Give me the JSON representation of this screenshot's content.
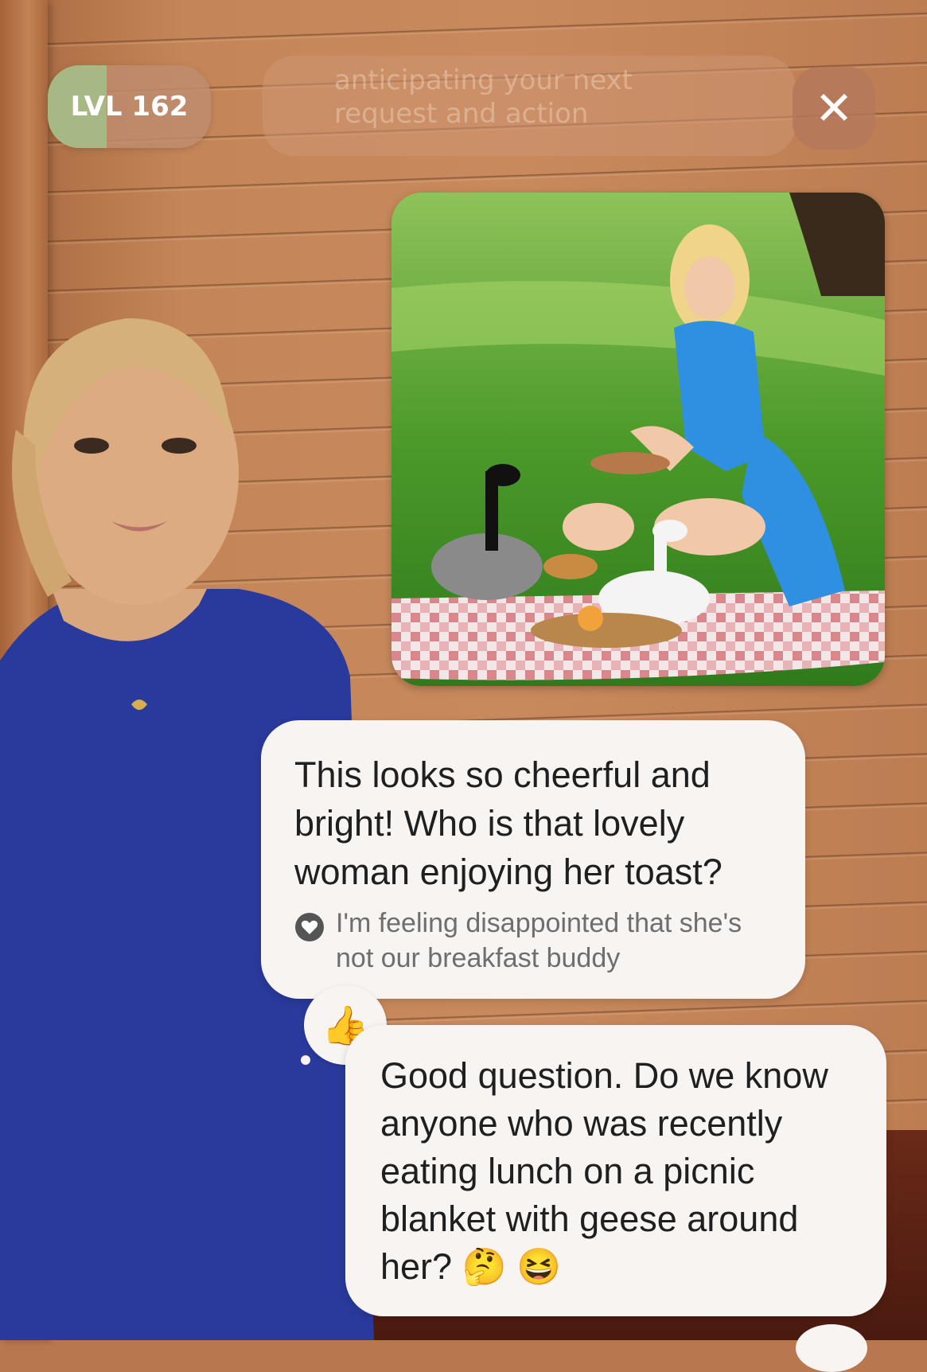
{
  "header": {
    "level_label": "LVL 162",
    "level_progress": 0.36,
    "hint_text": "anticipating your next request and action",
    "close_glyph": "✕"
  },
  "photo": {
    "icon": "image"
  },
  "chat": {
    "user_message": "This looks so cheerful and bright! Who is that lovely woman enjoying her toast?",
    "emotion_text": "I'm feeling disappointed that she's not our breakfast buddy",
    "emotion_icon": "heart-icon",
    "reaction_emoji": "👍",
    "ai_message": "Good question. Do we know anyone who was recently eating lunch on a picnic blanket with geese around her? 🤔 😆"
  },
  "colors": {
    "wall": "#c48658",
    "level_fill": "#a6b884",
    "bubble": "#f7f4f2",
    "avatar_dress": "#2a3a9c"
  }
}
